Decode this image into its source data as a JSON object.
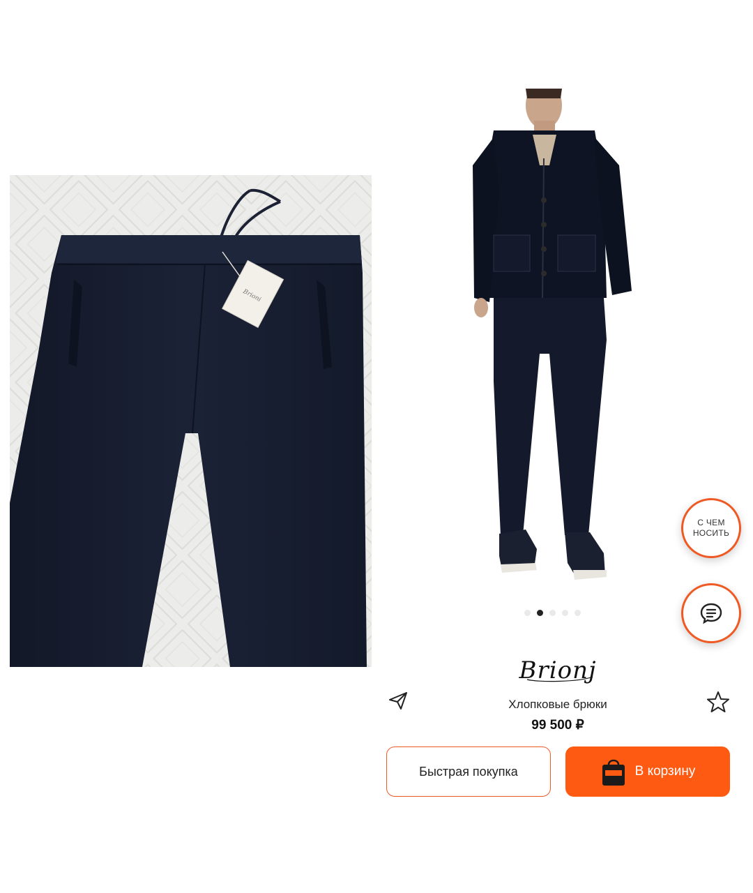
{
  "product": {
    "brand_logo_text": "Brioni",
    "name": "Хлопковые брюки",
    "price": "99 500 ₽"
  },
  "gallery": {
    "total_images": 5,
    "active_index": 1
  },
  "floating": {
    "wear_with_label": "С ЧЕМ НОСИТЬ",
    "chat_icon": "chat-bubble-icon"
  },
  "actions": {
    "quick_buy_label": "Быстрая покупка",
    "add_to_cart_label": "В корзину",
    "share_icon": "paper-plane-icon",
    "favorite_icon": "star-outline-icon"
  },
  "colors": {
    "accent": "#ff5a12",
    "accent_border": "#ef5a24",
    "product_navy": "#151c2e"
  }
}
